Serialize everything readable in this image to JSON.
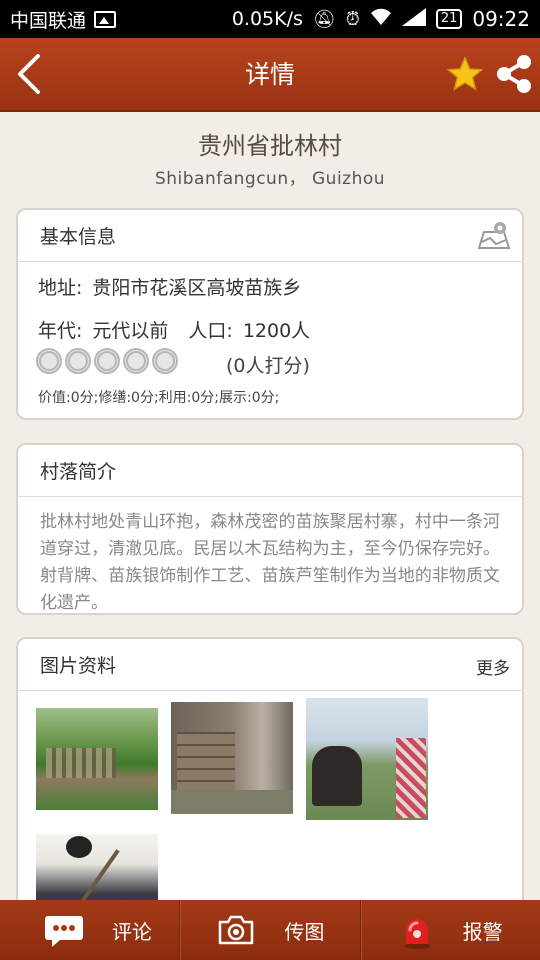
{
  "status_bar": {
    "carrier": "中国联通",
    "speed": "0.05K/s",
    "battery": "21",
    "time": "09:22"
  },
  "header": {
    "title": "详情",
    "icons": [
      "back-arrow-icon",
      "star-icon",
      "share-icon"
    ],
    "accent_color": "#a83a16"
  },
  "village": {
    "name": "贵州省批林村",
    "subtitle": "Shibanfangcun， Guizhou"
  },
  "basic_info": {
    "heading": "基本信息",
    "address_label": "地址:",
    "address_value": "贵阳市花溪区高坡苗族乡",
    "era_label": "年代:",
    "era_value": "元代以前",
    "population_label": "人口:",
    "population_value": "1200人",
    "rating_stars": 0,
    "rating_max": 5,
    "rating_count": "(0人打分)",
    "scores": "价值:0分;修缮:0分;利用:0分;展示:0分;"
  },
  "intro": {
    "heading": "村落简介",
    "text": "批林村地处青山环抱，森林茂密的苗族聚居村寨，村中一条河道穿过，清澈见底。民居以木瓦结构为主，至今仍保存完好。射背牌、苗族银饰制作工艺、苗族芦笙制作为当地的非物质文化遗产。"
  },
  "photos": {
    "heading": "图片资料",
    "more": "更多",
    "count": 4
  },
  "bottom_bar": {
    "comment": "评论",
    "upload": "传图",
    "alarm": "报警"
  }
}
